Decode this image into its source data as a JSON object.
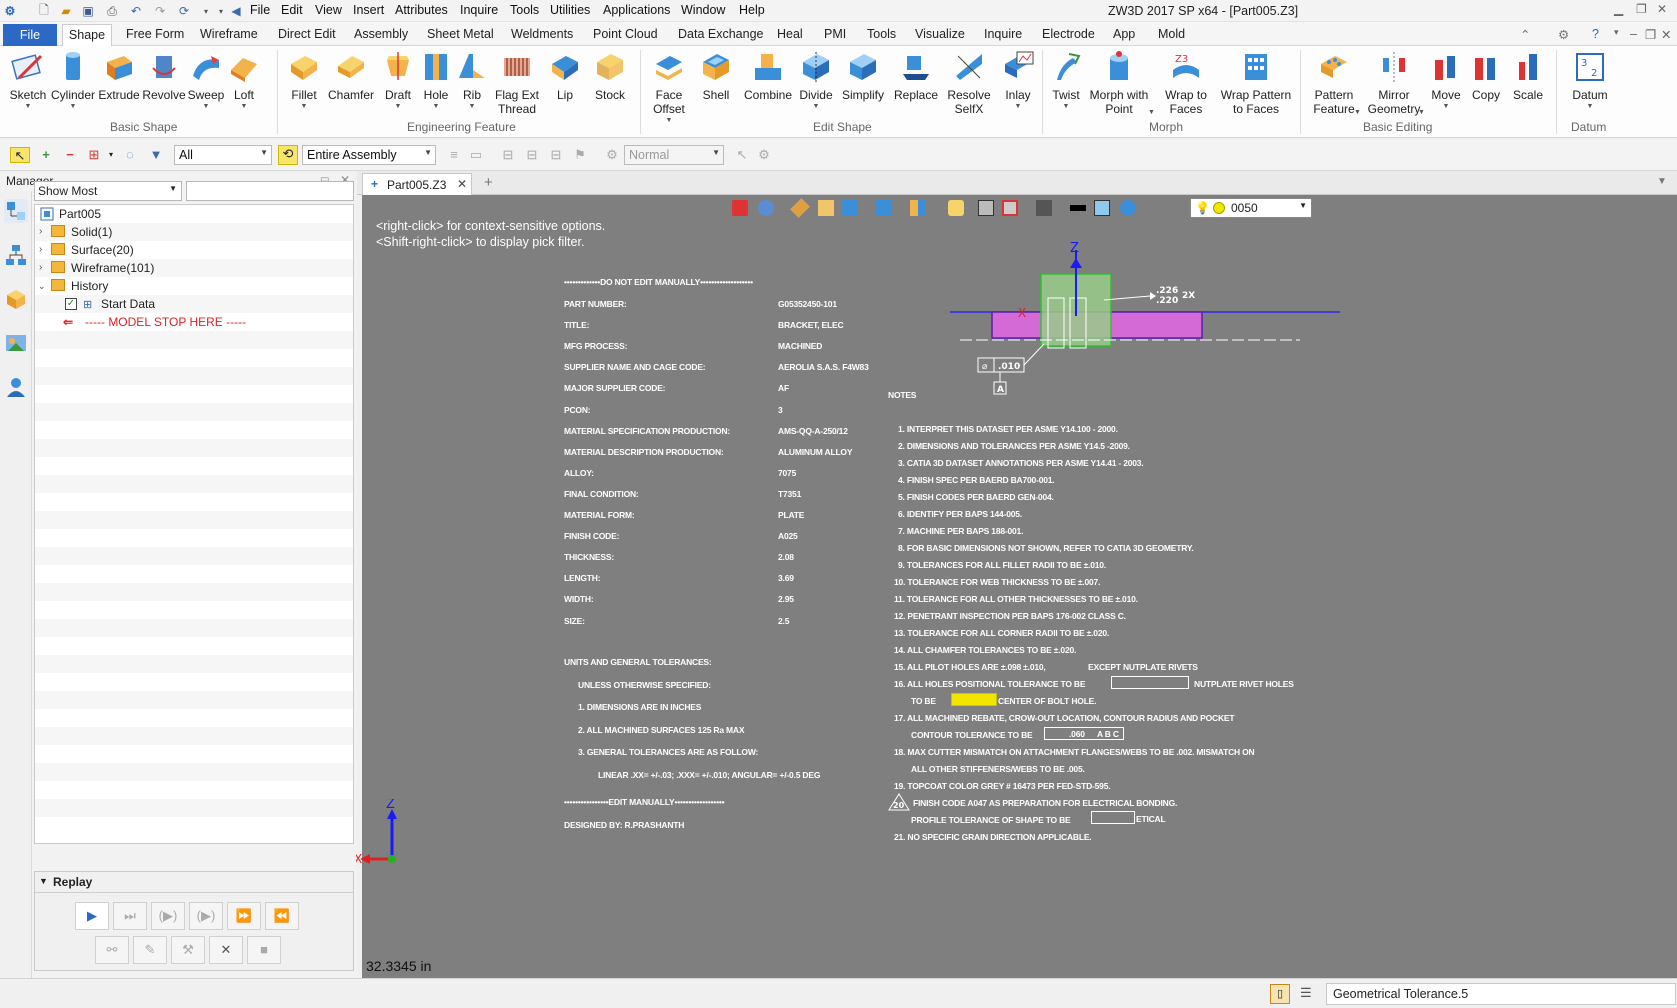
{
  "window": {
    "title": "ZW3D 2017 SP x64 - [Part005.Z3]",
    "menu": [
      "File",
      "Edit",
      "View",
      "Insert",
      "Attributes",
      "Inquire",
      "Tools",
      "Utilities",
      "Applications",
      "Window",
      "Help"
    ]
  },
  "ribbon_tabs": [
    "File",
    "Shape",
    "Free Form",
    "Wireframe",
    "Direct Edit",
    "Assembly",
    "Sheet Metal",
    "Weldments",
    "Point Cloud",
    "Data Exchange",
    "Heal",
    "PMI",
    "Tools",
    "Visualize",
    "Inquire",
    "Electrode",
    "App",
    "Mold"
  ],
  "ribbon": {
    "basic_shape": {
      "label": "Basic Shape",
      "buttons": [
        "Sketch",
        "Cylinder",
        "Extrude",
        "Revolve",
        "Sweep",
        "Loft"
      ]
    },
    "engineering_feature": {
      "label": "Engineering Feature",
      "buttons": [
        "Fillet",
        "Chamfer",
        "Draft",
        "Hole",
        "Rib",
        "Flag Ext\nThread",
        "Lip",
        "Stock"
      ]
    },
    "edit_shape": {
      "label": "Edit Shape",
      "buttons": [
        "Face\nOffset",
        "Shell",
        "Combine",
        "Divide",
        "Simplify",
        "Replace",
        "Resolve\nSelfX",
        "Inlay"
      ]
    },
    "morph": {
      "label": "Morph",
      "buttons": [
        "Twist",
        "Morph with\nPoint",
        "Wrap to\nFaces",
        "Wrap Pattern\nto Faces"
      ]
    },
    "basic_editing": {
      "label": "Basic Editing",
      "buttons": [
        "Pattern\nFeature",
        "Mirror\nGeometry",
        "Move",
        "Copy",
        "Scale"
      ]
    },
    "datum": {
      "label": "Datum",
      "buttons": [
        "Datum"
      ]
    }
  },
  "toolbar": {
    "filter_value": "All",
    "scope_value": "Entire Assembly",
    "mode_value": "Normal"
  },
  "manager": {
    "title": "Manager",
    "show_value": "Show Most",
    "tree": [
      {
        "label": "Part005",
        "level": 0
      },
      {
        "label": "Solid(1)",
        "level": 1
      },
      {
        "label": "Surface(20)",
        "level": 1
      },
      {
        "label": "Wireframe(101)",
        "level": 1
      },
      {
        "label": "History",
        "level": 1
      },
      {
        "label": "Start Data",
        "level": 2
      },
      {
        "label": "----- MODEL STOP HERE -----",
        "level": 2
      }
    ],
    "replay_label": "Replay"
  },
  "document": {
    "tab_label": "Part005.Z3",
    "layer_value": "0050",
    "hint_line1": "<right-click> for context-sensitive options.",
    "hint_line2": "<Shift-right-click> to display pick filter.",
    "measurement": "32.3345 in",
    "axis_z": "Z",
    "axis_x": "X"
  },
  "drawing": {
    "header": "•••••••••••••DO NOT EDIT MANUALLY•••••••••••••••••••",
    "fields": [
      [
        "PART NUMBER:",
        "G05352450-101"
      ],
      [
        "TITLE:",
        "BRACKET, ELEC"
      ],
      [
        "MFG PROCESS:",
        "MACHINED"
      ],
      [
        "SUPPLIER NAME AND CAGE CODE:",
        "AEROLIA S.A.S. F4W83"
      ],
      [
        "MAJOR SUPPLIER CODE:",
        "AF"
      ],
      [
        "PCON:",
        "3"
      ],
      [
        "MATERIAL SPECIFICATION PRODUCTION:",
        "AMS-QQ-A-250/12"
      ],
      [
        "MATERIAL DESCRIPTION PRODUCTION:",
        "ALUMINUM ALLOY"
      ],
      [
        "ALLOY:",
        "7075"
      ],
      [
        "FINAL CONDITION:",
        "T7351"
      ],
      [
        "MATERIAL FORM:",
        "PLATE"
      ],
      [
        "FINISH CODE:",
        "A025"
      ],
      [
        "THICKNESS:",
        "2.08"
      ],
      [
        "LENGTH:",
        "3.69"
      ],
      [
        "WIDTH:",
        "2.95"
      ],
      [
        "SIZE:",
        "2.5"
      ]
    ],
    "units_title": "UNITS AND GENERAL TOLERANCES:",
    "units_lines": [
      "UNLESS OTHERWISE SPECIFIED:",
      "1.    DIMENSIONS ARE IN INCHES",
      "2.    ALL MACHINED SURFACES 125 Ra MAX",
      "3. GENERAL TOLERANCES ARE AS FOLLOW:",
      "LINEAR .XX= +/-.03; .XXX= +/-.010; ANGULAR= +/-0.5 DEG"
    ],
    "footer": "••••••••••••••••EDIT MANUALLY••••••••••••••••••",
    "designed_by": "DESIGNED BY: R.PRASHANTH",
    "notes_title": "NOTES",
    "notes": [
      "1. INTERPRET THIS DATASET PER ASME Y14.100 - 2000.",
      "2. DIMENSIONS AND TOLERANCES PER ASME Y14.5 -2009.",
      "3. CATIA 3D DATASET ANNOTATIONS PER ASME Y14.41 - 2003.",
      "4. FINISH SPEC PER BAERD BA700-001.",
      "5. FINISH CODES PER BAERD GEN-004.",
      "6. IDENTIFY PER BAPS 144-005.",
      "7. MACHINE PER BAPS 188-001.",
      "8. FOR BASIC DIMENSIONS NOT SHOWN, REFER TO CATIA 3D GEOMETRY.",
      "9. TOLERANCES FOR ALL FILLET RADII TO BE ±.010.",
      "10. TOLERANCE FOR WEB THICKNESS TO BE ±.007.",
      "11. TOLERANCE FOR ALL OTHER THICKNESSES TO BE ±.010.",
      "12. PENETRANT INSPECTION PER BAPS 176-002 CLASS C.",
      "13. TOLERANCE FOR ALL CORNER RADII TO BE ±.020.",
      "14. ALL CHAMFER TOLERANCES TO BE ±.020.",
      "15. ALL PILOT HOLES ARE ±.098 ±.010,",
      "16. ALL HOLES POSITIONAL TOLERANCE TO BE",
      "TO BE",
      "17. ALL MACHINED REBATE, CROW-OUT LOCATION, CONTOUR RADIUS AND POCKET",
      "CONTOUR TOLERANCE TO BE",
      "18. MAX CUTTER MISMATCH ON ATTACHMENT FLANGES/WEBS TO BE .002.  MISMATCH ON",
      "ALL OTHER STIFFENERS/WEBS TO BE .005.",
      "19. TOPCOAT COLOR   GREY # 16473 PER FED-STD-595.",
      "FINISH CODE A047 AS PREPARATION FOR ELECTRICAL BONDING.",
      "PROFILE TOLERANCE OF SHAPE TO BE",
      "21. NO SPECIFIC GRAIN DIRECTION APPLICABLE."
    ],
    "note15_extra": "EXCEPT NUTPLATE RIVETS",
    "note16_extra": "NUTPLATE RIVET HOLES",
    "note16b_extra": "CENTER OF BOLT HOLE.",
    "note20_num": "20",
    "note20_extra": "ETICAL",
    "gdt_010": ".010",
    "gdt_a": "A",
    "gdt_060": ".060",
    "gdt_abc": "A B C",
    "dim_226": ".226",
    "dim_220": ".220",
    "dim_2x": "2X"
  },
  "status": {
    "text": "Geometrical Tolerance.5"
  },
  "colors": {
    "accent": "#2b69c4",
    "viewport_bg": "#7f7f7f",
    "warning_red": "#e02020",
    "highlight_yellow": "#f2e600"
  }
}
